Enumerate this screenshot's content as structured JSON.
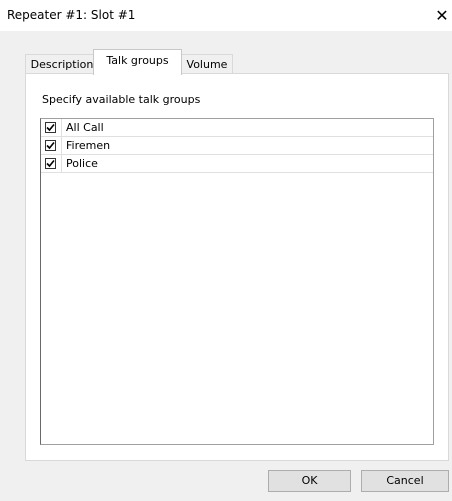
{
  "window": {
    "title": "Repeater #1: Slot #1",
    "close_glyph": "✕"
  },
  "tabs": [
    {
      "label": "Description",
      "selected": false
    },
    {
      "label": "Talk groups",
      "selected": true
    },
    {
      "label": "Volume",
      "selected": false
    }
  ],
  "panel": {
    "instruction": "Specify available talk groups",
    "talk_groups": [
      {
        "label": "All Call",
        "checked": true
      },
      {
        "label": "Firemen",
        "checked": true
      },
      {
        "label": "Police",
        "checked": true
      }
    ]
  },
  "buttons": {
    "ok_label": "OK",
    "cancel_label": "Cancel"
  }
}
